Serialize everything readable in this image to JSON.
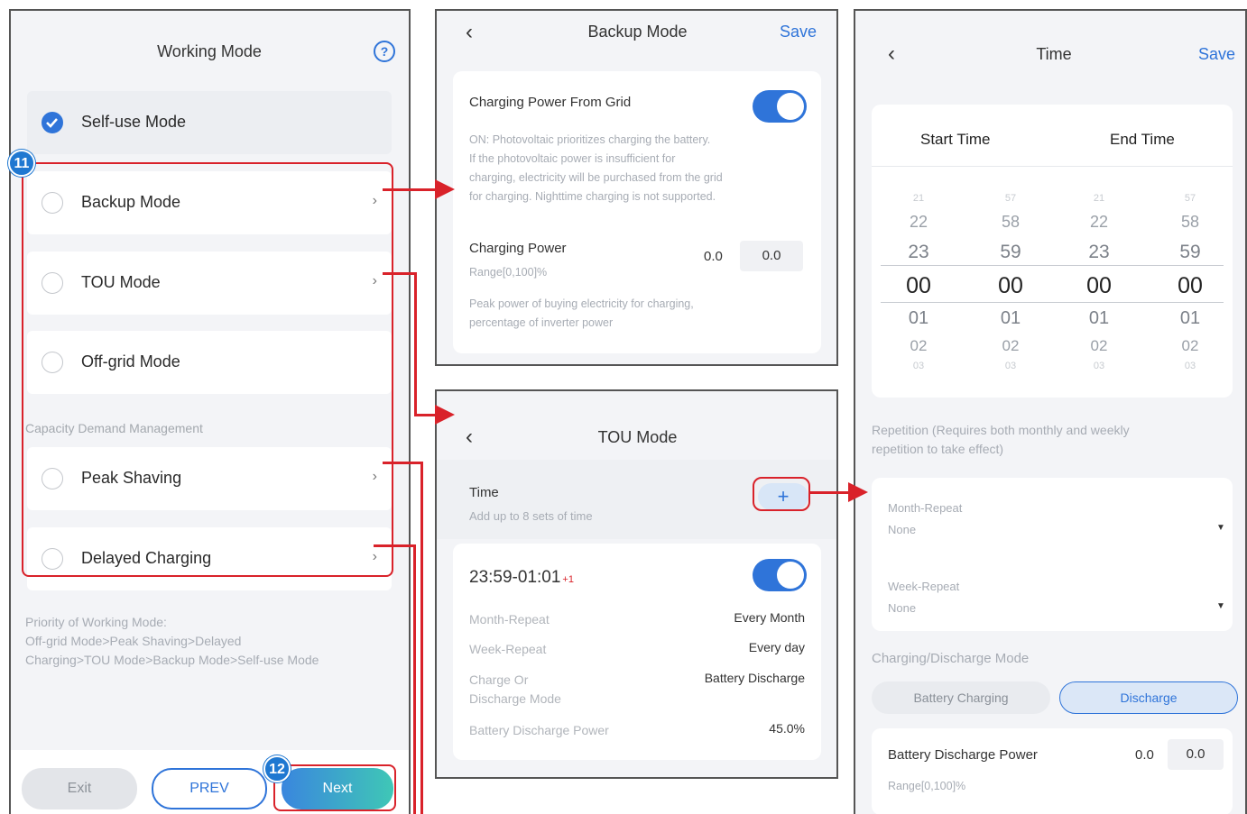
{
  "working_mode": {
    "title": "Working Mode",
    "help_icon": "question-circle-icon",
    "modes": [
      {
        "label": "Self-use Mode",
        "selected": true
      },
      {
        "label": "Backup Mode",
        "selected": false
      },
      {
        "label": "TOU Mode",
        "selected": false
      },
      {
        "label": "Off-grid Mode",
        "selected": false
      },
      {
        "label": "Peak Shaving",
        "selected": false
      },
      {
        "label": "Delayed Charging",
        "selected": false
      }
    ],
    "section_label": "Capacity Demand Management",
    "priority_text": [
      "Priority of Working Mode:",
      "Off-grid Mode>Peak Shaving>Delayed",
      "Charging>TOU Mode>Backup Mode>Self-use Mode"
    ],
    "exit_label": "Exit",
    "prev_label": "PREV",
    "next_label": "Next",
    "badge_11": "11",
    "badge_12": "12"
  },
  "backup_mode": {
    "title": "Backup Mode",
    "save_label": "Save",
    "grid_charging_label": "Charging Power From Grid",
    "grid_charging_desc": [
      "ON: Photovoltaic prioritizes charging the battery.",
      "If the photovoltaic power is insufficient for",
      "charging, electricity will be purchased from the grid",
      "for charging. Nighttime charging is not supported."
    ],
    "charging_power_label": "Charging Power",
    "charging_power_value": "0.0",
    "charging_power_input": "0.0",
    "range_label": "Range[0,100]%",
    "peak_desc": [
      "Peak power of buying electricity for charging,",
      "percentage of inverter power"
    ]
  },
  "tou_mode": {
    "title": "TOU Mode",
    "time_label": "Time",
    "time_hint": "Add up to 8 sets of time",
    "add_symbol": "+",
    "entry_time": "23:59-01:01",
    "entry_suffix": "+1",
    "rows": [
      {
        "label": "Month-Repeat",
        "value": "Every Month"
      },
      {
        "label": "Week-Repeat",
        "value": "Every day"
      },
      {
        "label": "Charge Or",
        "label2": "Discharge Mode",
        "value": "Battery Discharge"
      },
      {
        "label": "Battery Discharge Power",
        "value": "45.0%"
      }
    ]
  },
  "time_screen": {
    "title": "Time",
    "save_label": "Save",
    "start_label": "Start Time",
    "end_label": "End Time",
    "wheel_columns": [
      [
        "21",
        "22",
        "23",
        "00",
        "01",
        "02",
        "03"
      ],
      [
        "57",
        "58",
        "59",
        "00",
        "01",
        "02",
        "03"
      ],
      [
        "21",
        "22",
        "23",
        "00",
        "01",
        "02",
        "03"
      ],
      [
        "57",
        "58",
        "59",
        "00",
        "01",
        "02",
        "03"
      ]
    ],
    "repetition_text": [
      "Repetition (Requires both monthly and weekly",
      "repetition to take effect)"
    ],
    "month_repeat_label": "Month-Repeat",
    "month_repeat_value": "None",
    "week_repeat_label": "Week-Repeat",
    "week_repeat_value": "None",
    "mode_section_label": "Charging/Discharge Mode",
    "charging_option": "Battery Charging",
    "discharge_option": "Discharge",
    "discharge_power_label": "Battery Discharge Power",
    "discharge_power_value": "0.0",
    "discharge_power_input": "0.0",
    "discharge_range_label": "Range[0,100]%"
  },
  "colors": {
    "accent": "#2f74d9",
    "highlight": "#d9222a",
    "badge": "#1f78d1"
  }
}
